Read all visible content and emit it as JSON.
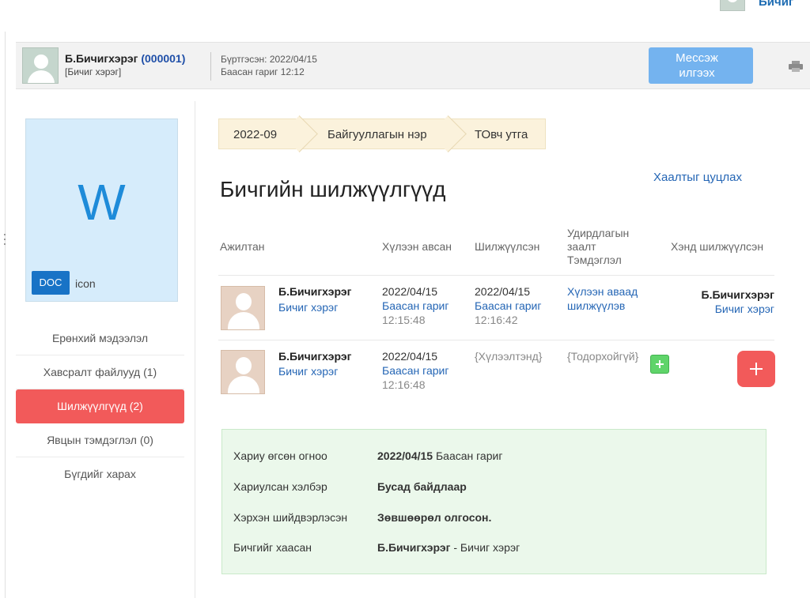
{
  "topbar": {
    "user_fragment": "Бичиг"
  },
  "header": {
    "user_name": "Б.Бичигхэрэг",
    "user_code": "(000001)",
    "user_role": "[Бичиг хэрэг]",
    "registered": "Бүртгэсэн: 2022/04/15",
    "registered_time": "Баасан гариг 12:12",
    "message_button": "Мессэж илгээх",
    "print_icon": "printer-icon"
  },
  "document": {
    "letter": "W",
    "badge": "DOC",
    "icon_label": "icon"
  },
  "menu": [
    {
      "label": "Ерөнхий мэдээлэл",
      "active": false
    },
    {
      "label": "Хавсралт файлууд (1)",
      "active": false
    },
    {
      "label": "Шилжүүлгүүд (2)",
      "active": true
    },
    {
      "label": "Явцын тэмдэглэл (0)",
      "active": false
    },
    {
      "label": "Бүгдийг харах",
      "active": false
    }
  ],
  "breadcrumb": [
    "2022-09",
    "Байгууллагын нэр",
    "ТОвч утга"
  ],
  "page_title": "Бичгийн шилжүүлгүүд",
  "close_link": "Хаалтыг цуцлах",
  "table": {
    "headers": {
      "employee": "Ажилтан",
      "received": "Хүлээн авсан",
      "transferred": "Шилжүүлсэн",
      "note": "Удирдлагын заалт Тэмдэглэл",
      "to_whom": "Хэнд шилжүүлсэн"
    },
    "rows": [
      {
        "name": "Б.Бичигхэрэг",
        "role": "Бичиг хэрэг",
        "received_date": "2022/04/15",
        "received_day": "Баасан гариг",
        "received_time": "12:15:48",
        "transferred_date": "2022/04/15",
        "transferred_day": "Баасан гариг",
        "transferred_time": "12:16:42",
        "note": "Хүлээн аваад шилжүүлэв",
        "to_name": "Б.Бичигхэрэг",
        "to_role": "Бичиг хэрэг"
      },
      {
        "name": "Б.Бичигхэрэг",
        "role": "Бичиг хэрэг",
        "received_date": "2022/04/15",
        "received_day": "Баасан гариг",
        "received_time": "12:16:48",
        "transferred_status": "{Хүлээлтэнд}",
        "note": "{Тодорхойгүй}",
        "add_note_icon": "plus-icon",
        "add_transfer_icon": "plus-icon"
      }
    ]
  },
  "summary": {
    "reply_date_label": "Хариу өгсөн огноо",
    "reply_date": "2022/04/15",
    "reply_day": "Баасан гариг",
    "reply_method_label": "Хариулсан хэлбэр",
    "reply_method": "Бусад байдлаар",
    "decision_label": "Хэрхэн шийдвэрлэсэн",
    "decision": "Зөвшөөрөл олгосон.",
    "closed_by_label": "Бичгийг хаасан",
    "closed_by_name": "Б.Бичигхэрэг",
    "closed_by_sep": " - ",
    "closed_by_role": "Бичиг хэрэг"
  }
}
